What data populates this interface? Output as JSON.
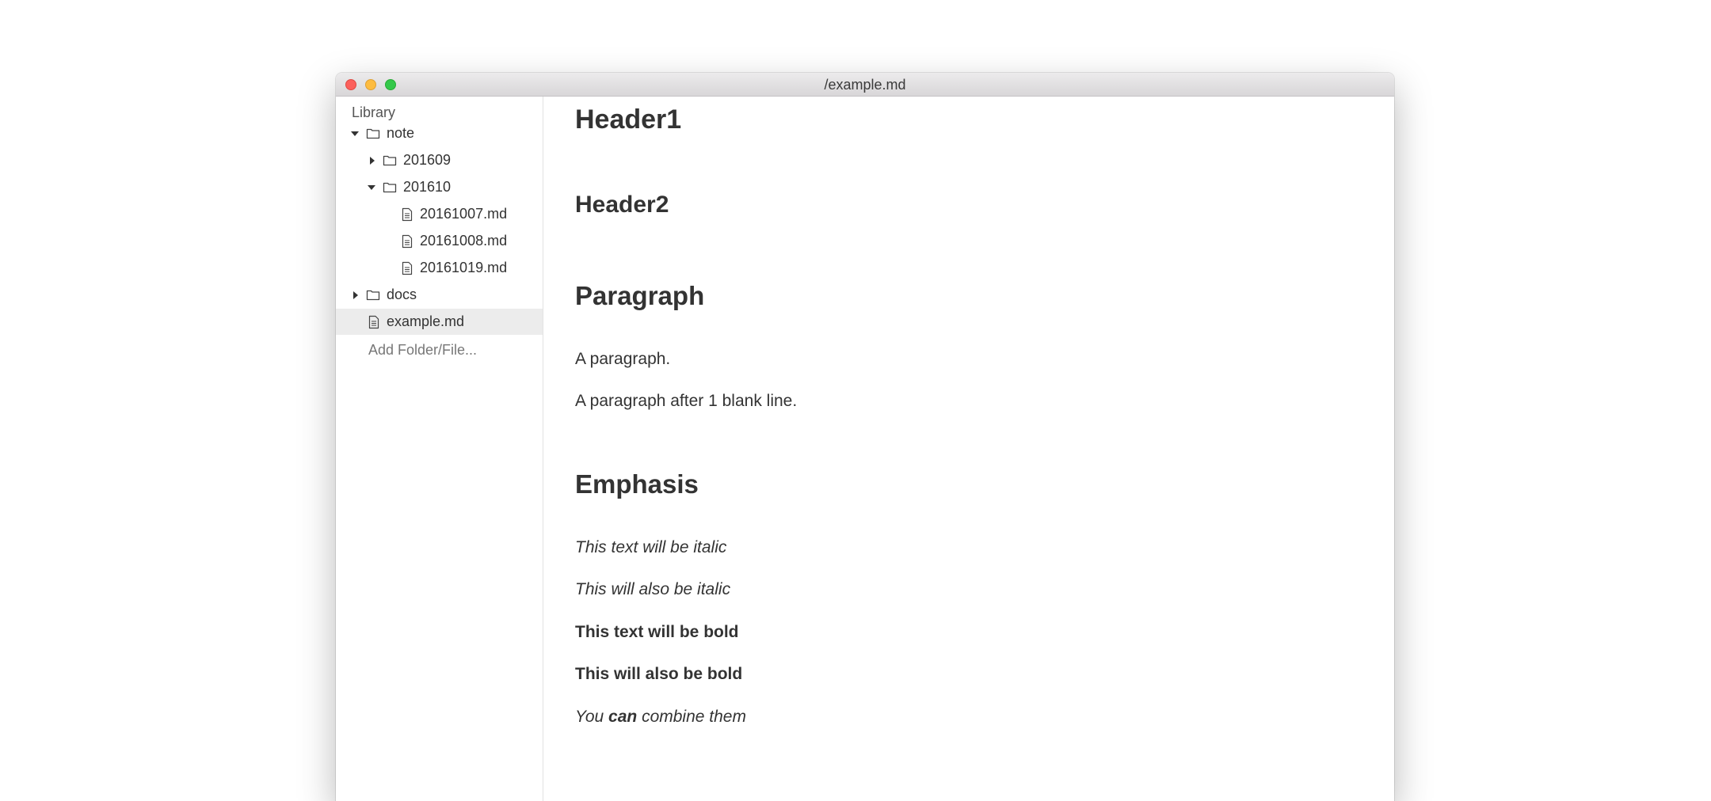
{
  "window": {
    "title": "/example.md"
  },
  "sidebar": {
    "library_label": "Library",
    "tree": [
      {
        "label": "note",
        "type": "folder",
        "expanded": true,
        "depth": 0
      },
      {
        "label": "201609",
        "type": "folder",
        "expanded": false,
        "depth": 1
      },
      {
        "label": "201610",
        "type": "folder",
        "expanded": true,
        "depth": 1
      },
      {
        "label": "20161007.md",
        "type": "file",
        "depth": 2
      },
      {
        "label": "20161008.md",
        "type": "file",
        "depth": 2
      },
      {
        "label": "20161019.md",
        "type": "file",
        "depth": 2
      },
      {
        "label": "docs",
        "type": "folder",
        "expanded": false,
        "depth": 0
      },
      {
        "label": "example.md",
        "type": "file",
        "depth": 0,
        "selected": true
      }
    ],
    "add_label": "Add Folder/File..."
  },
  "content": {
    "header1": "Header1",
    "header2": "Header2",
    "paragraph_heading": "Paragraph",
    "paragraph1": "A paragraph.",
    "paragraph2": "A paragraph after 1 blank line.",
    "emphasis_heading": "Emphasis",
    "italic1": "This text will be italic",
    "italic2": "This will also be italic",
    "bold1": "This text will be bold",
    "bold2": "This will also be bold",
    "combine_prefix": "You ",
    "combine_bold": "can",
    "combine_suffix": " combine them"
  }
}
